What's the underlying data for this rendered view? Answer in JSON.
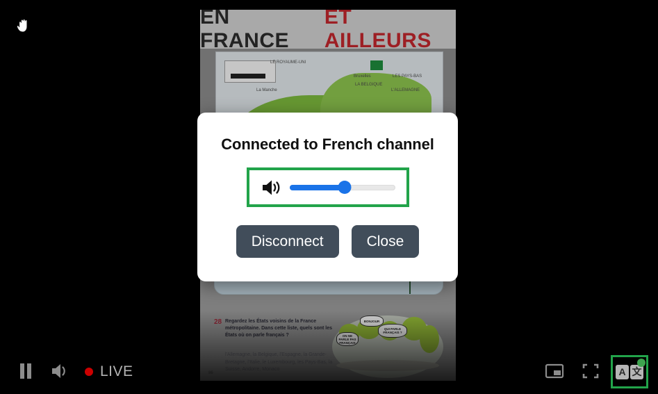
{
  "cursor": {
    "icon": "hand-grab-cursor"
  },
  "video": {
    "title_part1": "EN FRANCE",
    "title_part2": "ET AILLEURS",
    "map_labels": [
      "LE ROYAUME-UNI",
      "La Manche",
      "Bruxelles",
      "LA BELGIQUE",
      "LES PAYS-BAS",
      "L'ALLEMAGNE"
    ],
    "exercise_number": "28",
    "exercise_text": "Regardez les États voisins de la France métropolitaine. Dans cette liste, quels sont les États où on parle français ?",
    "exercise_list": "l'Allemagne, la Belgique, l'Espagne, la Grande-Bretagne, l'Italie, le Luxembourg, les Pays-Bas, la Suisse, Andorre, Monaco",
    "bubbles": [
      "BONJOUR",
      "QUI PARLE FRANÇAIS ?",
      "ON NE PARLE PAS FRANÇAIS"
    ],
    "page_number": "86"
  },
  "dialog": {
    "title": "Connected to French channel",
    "speaker_icon": "volume-high-icon",
    "volume": {
      "value": 52,
      "min": 0,
      "max": 100,
      "fill_color": "#1a73e8",
      "track_color": "#e8e8e8"
    },
    "highlight_color": "#22a44a",
    "buttons": [
      {
        "label": "Disconnect",
        "name": "disconnect-button"
      },
      {
        "label": "Close",
        "name": "close-button"
      }
    ]
  },
  "controls": {
    "play_pause": {
      "icon": "pause-icon",
      "state": "playing"
    },
    "volume": {
      "icon": "volume-high-icon"
    },
    "live": {
      "label": "LIVE",
      "dot_color": "#cc0000",
      "text_color": "#b3b3b3"
    },
    "pip": {
      "icon": "picture-in-picture-icon"
    },
    "fullscreen": {
      "icon": "fullscreen-icon"
    },
    "translate": {
      "icon": "translate-icon",
      "left_glyph": "A",
      "right_glyph": "文",
      "badge_color": "#3ea34f",
      "highlighted": true
    }
  }
}
